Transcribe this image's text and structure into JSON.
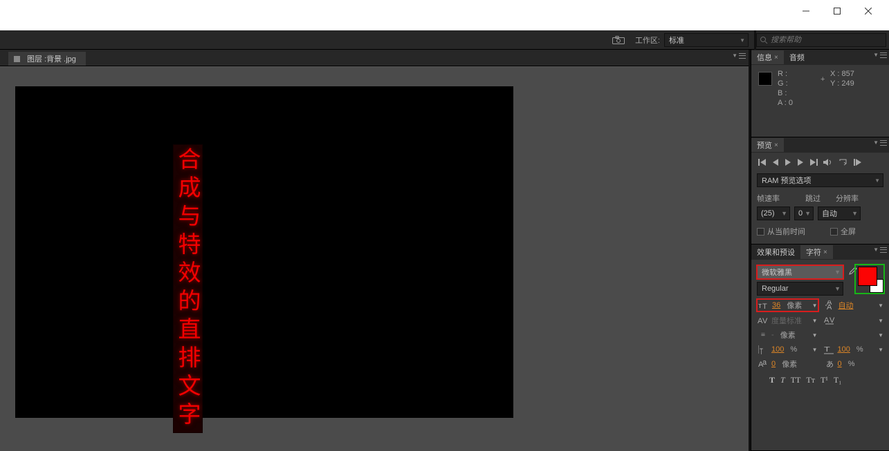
{
  "workspace": {
    "label": "工作区:",
    "value": "标准"
  },
  "search": {
    "placeholder": "搜索帮助"
  },
  "viewer": {
    "tab_label": "图层 :背景 .jpg",
    "vertical_text": "合成与特效的直排文字"
  },
  "info": {
    "tab1": "信息",
    "tab2": "音频",
    "r": "R :",
    "g": "G :",
    "b": "B :",
    "a": "A :  0",
    "x": "X : 857",
    "y": "Y : 249"
  },
  "preview": {
    "tab": "预览",
    "ram": "RAM 预览选项",
    "frame_rate_label": "帧速率",
    "skip_label": "跳过",
    "resolution_label": "分辨率",
    "frame_rate_value": "(25)",
    "skip_value": "0",
    "resolution_value": "自动",
    "from_current": "从当前时间",
    "fullscreen": "全屏"
  },
  "char": {
    "tab1": "效果和预设",
    "tab2": "字符",
    "font": "微软雅黑",
    "weight": "Regular",
    "size": "36",
    "size_unit": "像素",
    "leading": "自动",
    "kerning": "度量标准",
    "stroke_unit": "像素",
    "hscale": "100",
    "hscale_unit": "%",
    "vscale": "100",
    "vscale_unit": "%",
    "baseline": "0",
    "baseline_unit": "像素",
    "tsume": "0",
    "tsume_unit": "%",
    "style_bold": "T",
    "style_italic": "T",
    "style_caps": "TT",
    "style_small": "Tᴛ",
    "style_super": "T¹",
    "style_sub": "T₁"
  }
}
